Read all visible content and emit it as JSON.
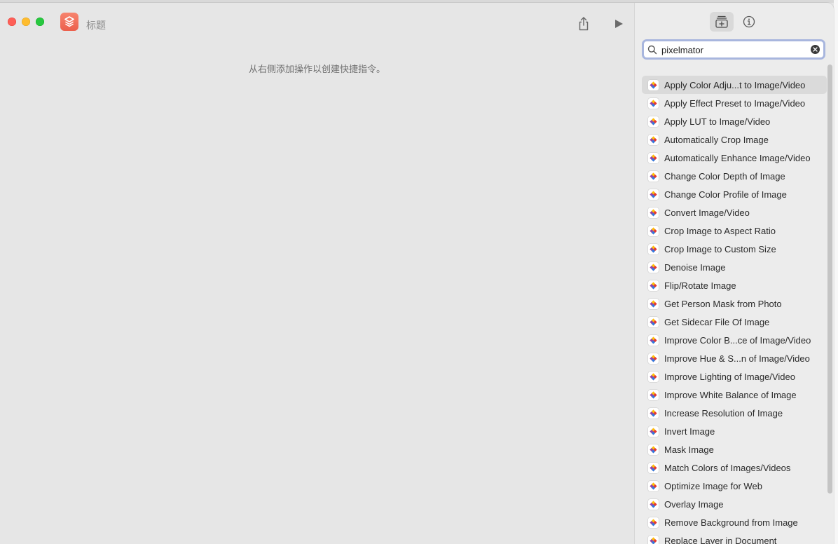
{
  "window": {
    "title": "标题",
    "hint": "从右侧添加操作以创建快捷指令。"
  },
  "toolbar": {
    "share_icon": "share-icon",
    "run_icon": "play-icon"
  },
  "sidebar": {
    "tabs": [
      {
        "icon": "library-add-icon",
        "selected": true
      },
      {
        "icon": "info-icon",
        "selected": false
      }
    ],
    "search": {
      "value": "pixelmator",
      "placeholder": "Search"
    },
    "items": [
      {
        "label": "Apply Color Adju...t to Image/Video",
        "selected": true
      },
      {
        "label": "Apply Effect Preset to Image/Video"
      },
      {
        "label": "Apply LUT to Image/Video"
      },
      {
        "label": "Automatically Crop Image"
      },
      {
        "label": "Automatically Enhance Image/Video"
      },
      {
        "label": "Change Color Depth of Image"
      },
      {
        "label": "Change Color Profile of Image"
      },
      {
        "label": "Convert Image/Video"
      },
      {
        "label": "Crop Image to Aspect Ratio"
      },
      {
        "label": "Crop Image to Custom Size"
      },
      {
        "label": "Denoise Image"
      },
      {
        "label": "Flip/Rotate Image"
      },
      {
        "label": "Get Person Mask from Photo"
      },
      {
        "label": "Get Sidecar File Of Image"
      },
      {
        "label": "Improve Color B...ce of Image/Video"
      },
      {
        "label": "Improve Hue & S...n of Image/Video"
      },
      {
        "label": "Improve Lighting of Image/Video"
      },
      {
        "label": "Improve White Balance of Image"
      },
      {
        "label": "Increase Resolution of Image"
      },
      {
        "label": "Invert Image"
      },
      {
        "label": "Mask Image"
      },
      {
        "label": "Match Colors of Images/Videos"
      },
      {
        "label": "Optimize Image for Web"
      },
      {
        "label": "Overlay Image"
      },
      {
        "label": "Remove Background from Image"
      },
      {
        "label": "Replace Layer in Document"
      }
    ]
  }
}
